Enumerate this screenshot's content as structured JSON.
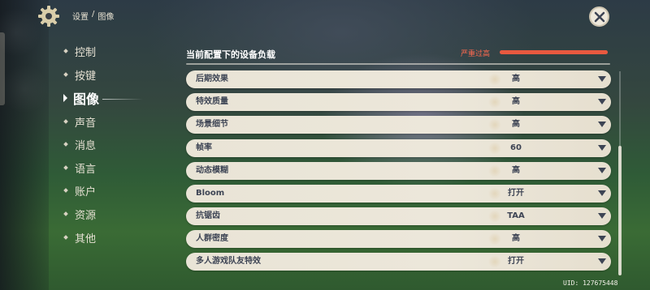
{
  "header": {
    "breadcrumb_root": "设置",
    "breadcrumb_sep": "/",
    "breadcrumb_current": "图像"
  },
  "nav": {
    "items": [
      {
        "label": "控制",
        "active": false
      },
      {
        "label": "按键",
        "active": false
      },
      {
        "label": "图像",
        "active": true
      },
      {
        "label": "声音",
        "active": false
      },
      {
        "label": "消息",
        "active": false
      },
      {
        "label": "语言",
        "active": false
      },
      {
        "label": "账户",
        "active": false
      },
      {
        "label": "资源",
        "active": false
      },
      {
        "label": "其他",
        "active": false
      }
    ]
  },
  "load": {
    "title": "当前配置下的设备负载",
    "status": "严重过高",
    "level": 1.0,
    "color": "#e8593f"
  },
  "settings": [
    {
      "label": "后期效果",
      "value": "高"
    },
    {
      "label": "特效质量",
      "value": "高"
    },
    {
      "label": "场景细节",
      "value": "高"
    },
    {
      "label": "帧率",
      "value": "60"
    },
    {
      "label": "动态模糊",
      "value": "高"
    },
    {
      "label": "Bloom",
      "value": "打开"
    },
    {
      "label": "抗锯齿",
      "value": "TAA"
    },
    {
      "label": "人群密度",
      "value": "高"
    },
    {
      "label": "多人游戏队友特效",
      "value": "打开"
    }
  ],
  "footer": {
    "uid": "UID: 127675448"
  }
}
